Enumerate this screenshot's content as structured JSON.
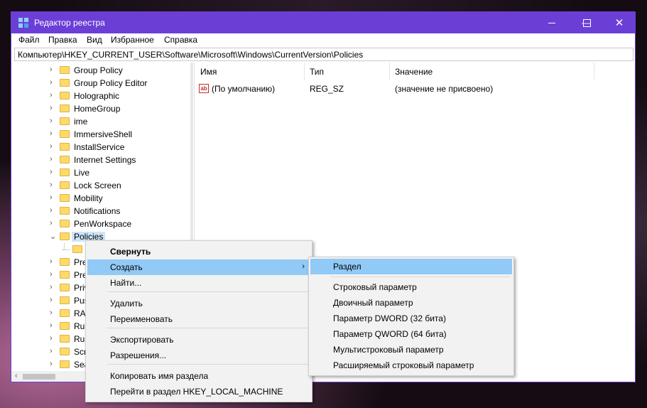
{
  "window": {
    "title": "Редактор реестра",
    "controls": {
      "minimize": "—",
      "maximize": "☐",
      "close": "✕"
    }
  },
  "menubar": [
    "Файл",
    "Правка",
    "Вид",
    "Избранное",
    "Справка"
  ],
  "address": "Компьютер\\HKEY_CURRENT_USER\\Software\\Microsoft\\Windows\\CurrentVersion\\Policies",
  "tree": {
    "items": [
      {
        "label": "Group Policy",
        "expander": "›"
      },
      {
        "label": "Group Policy Editor",
        "expander": "›"
      },
      {
        "label": "Holographic",
        "expander": "›"
      },
      {
        "label": "HomeGroup",
        "expander": "›"
      },
      {
        "label": "ime",
        "expander": "›"
      },
      {
        "label": "ImmersiveShell",
        "expander": "›"
      },
      {
        "label": "InstallService",
        "expander": "›"
      },
      {
        "label": "Internet Settings",
        "expander": "›"
      },
      {
        "label": "Live",
        "expander": "›"
      },
      {
        "label": "Lock Screen",
        "expander": "›"
      },
      {
        "label": "Mobility",
        "expander": "›"
      },
      {
        "label": "Notifications",
        "expander": "›"
      },
      {
        "label": "PenWorkspace",
        "expander": "›"
      },
      {
        "label": "Policies",
        "expander": "⌄",
        "selected": true
      },
      {
        "label": "",
        "expander": "",
        "child": true
      },
      {
        "label": "Pre",
        "expander": "›"
      },
      {
        "label": "Pre",
        "expander": "›"
      },
      {
        "label": "Priv",
        "expander": "›"
      },
      {
        "label": "Pus",
        "expander": "›"
      },
      {
        "label": "RAI",
        "expander": "›"
      },
      {
        "label": "Run",
        "expander": "›"
      },
      {
        "label": "Run",
        "expander": "›"
      },
      {
        "label": "Scr",
        "expander": "›"
      },
      {
        "label": "Sea",
        "expander": "›"
      }
    ]
  },
  "list": {
    "headers": {
      "name": "Имя",
      "type": "Тип",
      "value": "Значение"
    },
    "rows": [
      {
        "icon": "ab",
        "name": "(По умолчанию)",
        "type": "REG_SZ",
        "value": "(значение не присвоено)"
      }
    ]
  },
  "context_menu": {
    "items": [
      {
        "label": "Свернуть",
        "bold": true
      },
      {
        "label": "Создать",
        "highlighted": true,
        "submenu_arrow": "›"
      },
      {
        "label": "Найти..."
      },
      {
        "label": "Удалить"
      },
      {
        "label": "Переименовать"
      },
      {
        "label": "Экспортировать"
      },
      {
        "label": "Разрешения..."
      },
      {
        "label": "Копировать имя раздела"
      },
      {
        "label": "Перейти в раздел HKEY_LOCAL_MACHINE"
      }
    ]
  },
  "submenu": {
    "items": [
      {
        "label": "Раздел",
        "highlighted": true
      },
      {
        "label": "Строковый параметр"
      },
      {
        "label": "Двоичный параметр"
      },
      {
        "label": "Параметр DWORD (32 бита)"
      },
      {
        "label": "Параметр QWORD (64 бита)"
      },
      {
        "label": "Мультистроковый параметр"
      },
      {
        "label": "Расширяемый строковый параметр"
      }
    ]
  },
  "colors": {
    "titlebar": "#6b3fd6",
    "highlight": "#91c9f7",
    "selection": "#cce4f7"
  }
}
